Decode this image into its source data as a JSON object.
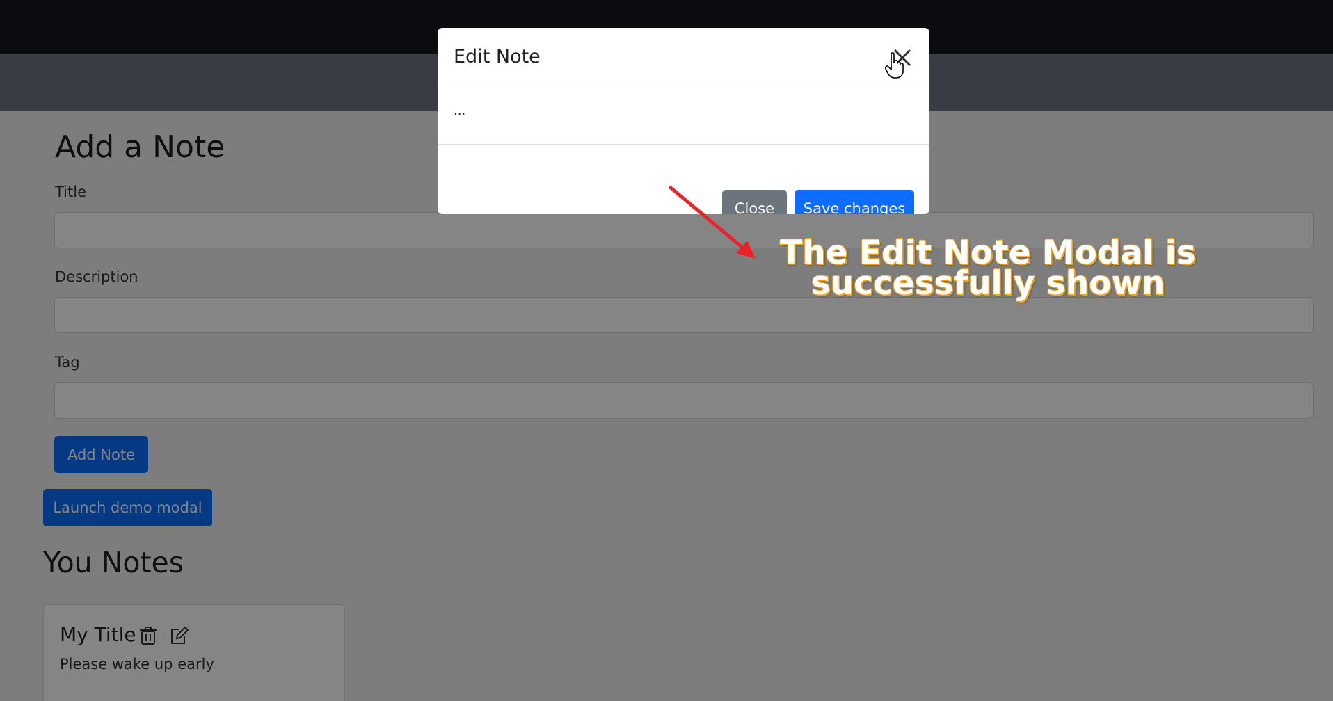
{
  "page": {
    "form_heading": "Add a Note",
    "title_label": "Title",
    "description_label": "Description",
    "tag_label": "Tag",
    "add_button": "Add Note",
    "launch_button": "Launch demo modal",
    "notes_heading": "You Notes",
    "note": {
      "title": "My Title",
      "description": "Please wake up early",
      "delete_icon": "trash-icon",
      "edit_icon": "edit-icon"
    }
  },
  "modal": {
    "title": "Edit Note",
    "body": "...",
    "close_button": "Close",
    "save_button": "Save changes",
    "close_icon": "close-icon"
  },
  "annotation": {
    "line1": "The Edit Note Modal is",
    "line2": "successfully shown",
    "arrow_color": "#e8232a",
    "text_outline_color": "#e8a425"
  },
  "colors": {
    "primary": "#0d6efd",
    "secondary": "#6c757d",
    "topbar": "#15171d",
    "navbar": "#6a7484"
  }
}
